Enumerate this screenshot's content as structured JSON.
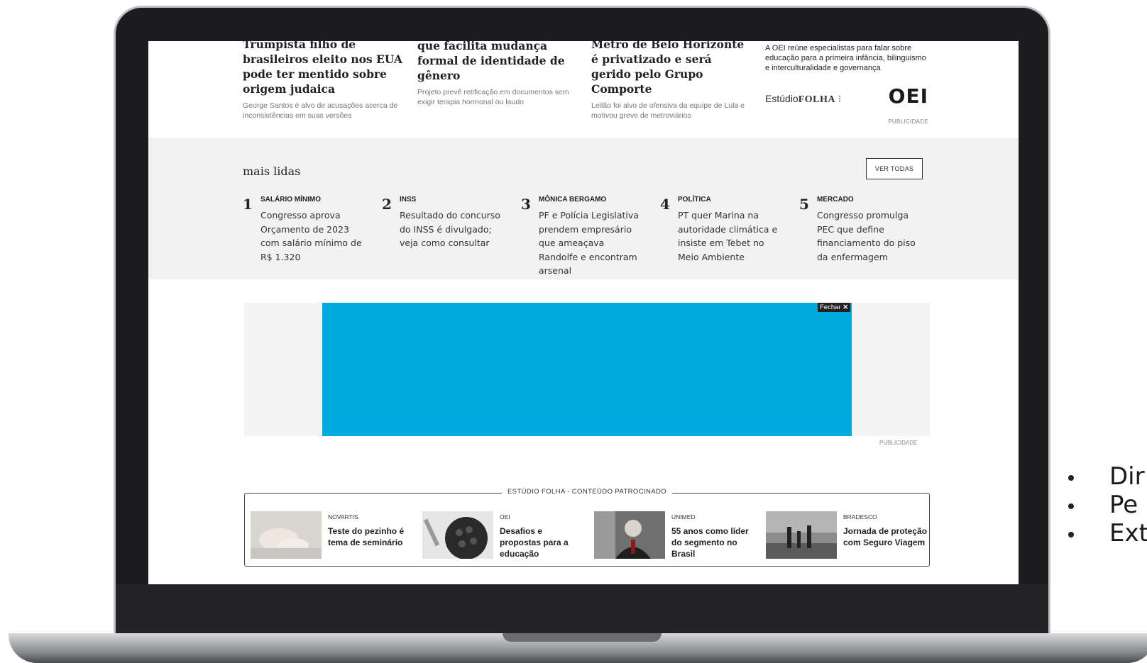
{
  "top_news": [
    {
      "title": "Trumpista filho de brasileiros eleito nos EUA pode ter mentido sobre origem judaica",
      "subtitle": "George Santos é alvo de acusações acerca de inconsistências em suas versões"
    },
    {
      "title": "que facilita mudança formal de identidade de gênero",
      "subtitle": "Projeto prevê retificação em documentos sem exigir terapia hormonal ou laudo"
    },
    {
      "title": "Metrô de Belo Horizonte é privatizado e será gerido pelo Grupo Comporte",
      "subtitle": "Leilão foi alvo de ofensiva da equipe de Lula e motivou greve de metroviários"
    }
  ],
  "ad_oei": {
    "text": "A OEI reúne especialistas para falar sobre educação para a primeira infância, bilinguismo e interculturalidade e governança",
    "estudio_prefix": "Estúdio",
    "estudio_brand": "FOLHA",
    "estudio_mark": "⁝",
    "logo": "OEI",
    "publicidade": "PUBLICIDADE"
  },
  "mais_lidas": {
    "title": "mais lidas",
    "ver_todas": "VER TODAS",
    "items": [
      {
        "num": "1",
        "category": "SALÁRIO MÍNIMO",
        "text": "Congresso aprova Orçamento de 2023 com salário mínimo de R$ 1.320"
      },
      {
        "num": "2",
        "category": "INSS",
        "text": "Resultado do concurso do INSS é divulgado; veja como consultar"
      },
      {
        "num": "3",
        "category": "MÔNICA BERGAMO",
        "text": "PF e Polícia Legislativa prendem empresário que ameaçava Randolfe e encontram arsenal"
      },
      {
        "num": "4",
        "category": "POLÍTICA",
        "text": "PT quer Marina na autoridade climática e insiste em Tebet no Meio Ambiente"
      },
      {
        "num": "5",
        "category": "MERCADO",
        "text": "Congresso promulga PEC que define financiamento do piso da enfermagem"
      }
    ]
  },
  "banner": {
    "close_label": "Fechar",
    "close_icon": "close-icon",
    "publicidade": "PUBLICIDADE",
    "color": "#00a9e0"
  },
  "estudio_folha": {
    "header": "ESTÚDIO FOLHA - CONTEÚDO PATROCINADO",
    "cards": [
      {
        "brand": "NOVARTIS",
        "title": "Teste do pezinho é tema de seminário"
      },
      {
        "brand": "OEI",
        "title": "Desafios e propostas para a educação"
      },
      {
        "brand": "UNIMED",
        "title": "55 anos como líder do segmento no Brasil"
      },
      {
        "brand": "BRADESCO",
        "title": "Jornada de proteção com Seguro Viagem"
      }
    ]
  },
  "slide_bullets": [
    "Dir",
    "Pe",
    "Ext"
  ]
}
